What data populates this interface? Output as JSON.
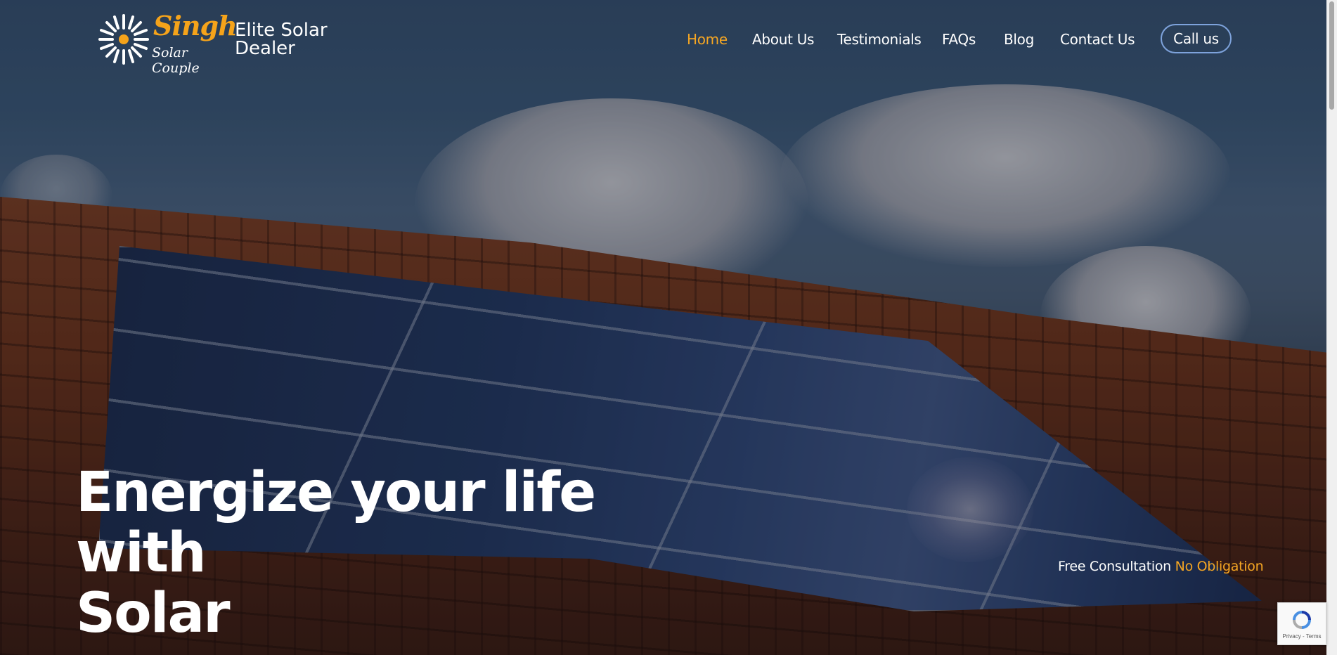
{
  "brand": {
    "script_name": "Singh",
    "script_sub": "Solar Couple",
    "title_line1": "Elite Solar",
    "title_line2": "Dealer"
  },
  "nav": {
    "items": [
      {
        "label": "Home",
        "active": true
      },
      {
        "label": "About Us"
      },
      {
        "label": "Testimonials"
      },
      {
        "label": "FAQs"
      },
      {
        "label": "Blog"
      },
      {
        "label": "Contact Us"
      }
    ],
    "cta_label": "Call us"
  },
  "hero": {
    "headline_line1": "Energize your life with",
    "headline_line2": "Solar",
    "consult_label": "Free Consultation",
    "consult_accent": "No Obligation"
  },
  "recaptcha": {
    "footer": "Privacy - Terms",
    "icon": "recaptcha-icon"
  },
  "colors": {
    "accent": "#f5a623",
    "button_border": "#7ea3dc",
    "text": "#ffffff"
  }
}
